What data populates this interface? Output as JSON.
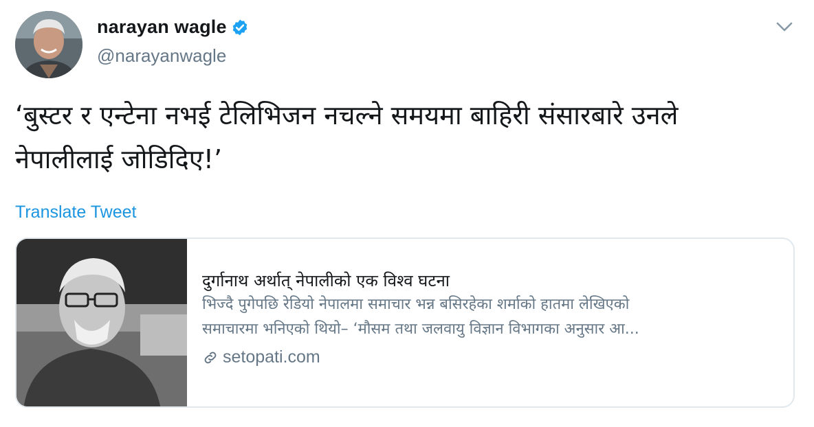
{
  "author": {
    "name": "narayan wagle",
    "handle": "@narayanwagle",
    "verified": true
  },
  "tweet": {
    "text_line1": "‘बुस्टर र एन्टेना नभई टेलिभिजन नचल्ने समयमा बाहिरी संसारबारे उनले",
    "text_line2": "नेपालीलाई जोडिदिए!’",
    "translate_label": "Translate Tweet"
  },
  "card": {
    "title": "दुर्गानाथ अर्थात् नेपालीको एक विश्व घटना",
    "desc_line1": "भिज्दै पुगेपछि रेडियो नेपालमा समाचार भन्न बसिरहेका शर्माको हातमा लेखिएको",
    "desc_line2": "समाचारमा भनिएको थियो– ‘मौसम तथा जलवायु विज्ञान विभागका अनुसार आ...",
    "domain": "setopati.com"
  },
  "colors": {
    "link": "#1b95e0",
    "secondary_text": "#657786",
    "verified_badge": "#1da1f2",
    "border": "#e1e8ed"
  },
  "icons": {
    "verified": "verified-badge-icon",
    "menu": "chevron-down-icon",
    "link": "link-icon"
  }
}
